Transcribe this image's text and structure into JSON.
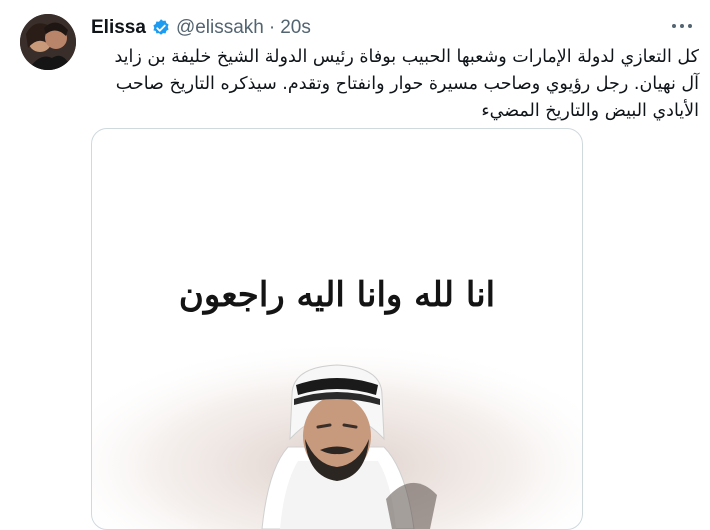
{
  "tweet": {
    "author_name": "Elissa",
    "handle": "@elissakh",
    "separator": "·",
    "time": "20s",
    "verified_icon": "verified-badge-icon",
    "more_icon": "more-options-icon",
    "text_lines": [
      "كل التعازي لدولة الإمارات وشعبها الحبيب بوفاة رئيس الدولة الشيخ خليفة بن زايد",
      "آل نهيان. رجل رؤيوي وصاحب مسيرة حوار وانفتاح وتقدم. سيذكره التاريخ صاحب",
      "الأيادي البيض والتاريخ المضيء"
    ]
  },
  "media": {
    "condolence_text": "انا لله وانا اليه راجعون",
    "portrait": "portrait-image"
  },
  "colors": {
    "accent": "#1d9bf0",
    "text": "#0f1419",
    "secondary": "#536471",
    "border": "#cfd9de"
  }
}
